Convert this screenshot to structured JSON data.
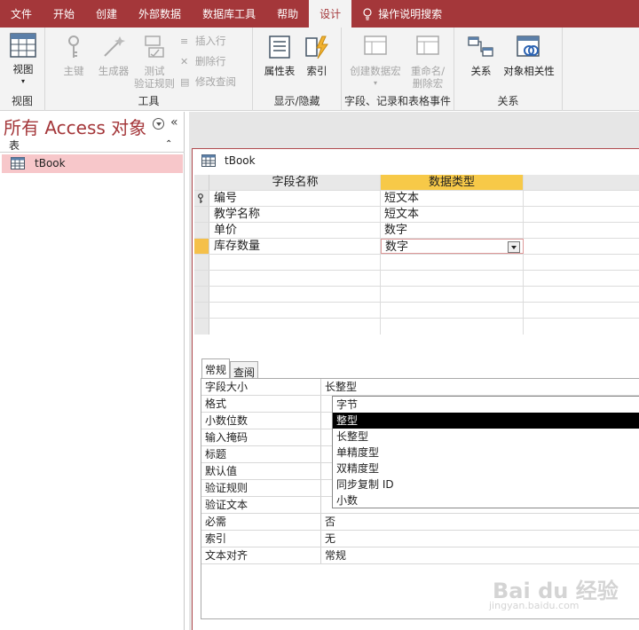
{
  "tabs": [
    {
      "label": "文件",
      "active": false
    },
    {
      "label": "开始",
      "active": false
    },
    {
      "label": "创建",
      "active": false
    },
    {
      "label": "外部数据",
      "active": false
    },
    {
      "label": "数据库工具",
      "active": false
    },
    {
      "label": "帮助",
      "active": false
    },
    {
      "label": "设计",
      "active": true
    }
  ],
  "tell_me": "操作说明搜索",
  "ribbon": {
    "groups": {
      "view": "视图",
      "tools": "工具",
      "show_hide": "显示/隐藏",
      "events": "字段、记录和表格事件",
      "relations": "关系"
    },
    "buttons": {
      "view": "视图",
      "primary_key": "主键",
      "builder": "生成器",
      "test_rules_1": "测试",
      "test_rules_2": "验证规则",
      "insert_rows": "插入行",
      "delete_rows": "删除行",
      "modify_lookups": "修改查阅",
      "property_sheet": "属性表",
      "indexes": "索引",
      "create_macro": "创建数据宏",
      "rename_delete_macro_1": "重命名/",
      "rename_delete_macro_2": "删除宏",
      "relationships": "关系",
      "object_dependencies": "对象相关性"
    }
  },
  "nav": {
    "title": "所有 Access 对象",
    "collapse": "«",
    "section": "表",
    "section_chevron": "⌃",
    "items": [
      {
        "label": "tBook"
      }
    ]
  },
  "document": {
    "tab_label": "tBook",
    "grid": {
      "headers": [
        "字段名称",
        "数据类型"
      ],
      "rows": [
        {
          "name": "编号",
          "type": "短文本"
        },
        {
          "name": "教学名称",
          "type": "短文本"
        },
        {
          "name": "单价",
          "type": "数字"
        },
        {
          "name": "库存数量",
          "type": "数字"
        }
      ]
    },
    "property_tabs": [
      "常规",
      "查阅"
    ],
    "properties": [
      {
        "key": "字段大小",
        "value": "长整型"
      },
      {
        "key": "格式",
        "value": ""
      },
      {
        "key": "小数位数",
        "value": ""
      },
      {
        "key": "输入掩码",
        "value": ""
      },
      {
        "key": "标题",
        "value": ""
      },
      {
        "key": "默认值",
        "value": ""
      },
      {
        "key": "验证规则",
        "value": ""
      },
      {
        "key": "验证文本",
        "value": ""
      },
      {
        "key": "必需",
        "value": "否"
      },
      {
        "key": "索引",
        "value": "无"
      },
      {
        "key": "文本对齐",
        "value": "常规"
      }
    ],
    "dropdown_options": [
      {
        "label": "字节",
        "selected": false
      },
      {
        "label": "整型",
        "selected": true
      },
      {
        "label": "长整型",
        "selected": false
      },
      {
        "label": "单精度型",
        "selected": false
      },
      {
        "label": "双精度型",
        "selected": false
      },
      {
        "label": "同步复制 ID",
        "selected": false
      },
      {
        "label": "小数",
        "selected": false
      }
    ]
  },
  "watermark": {
    "line1": "Bai du 经验",
    "line2": "jingyan.baidu.com"
  },
  "colors": {
    "accent": "#a4373a",
    "header_highlight": "#f7c948",
    "selected_nav": "#f7c7ca"
  }
}
